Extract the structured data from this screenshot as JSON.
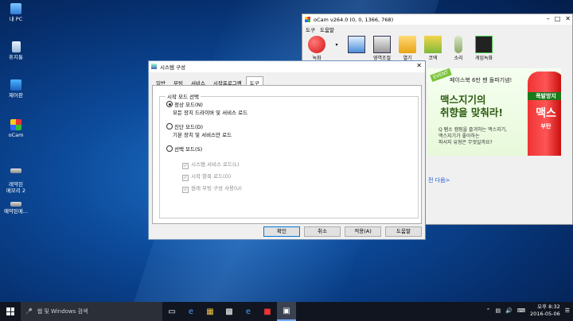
{
  "desktop": {
    "icons": [
      {
        "label": "내 PC",
        "icon": "this-pc-icon"
      },
      {
        "label": "휴지통",
        "icon": "recycle-bin-icon"
      },
      {
        "label": "제어판",
        "icon": "control-panel-icon"
      },
      {
        "label": "oCam",
        "icon": "ocam-icon"
      },
      {
        "label": "레약된\n메모리 2",
        "icon": "memory-icon"
      },
      {
        "label": "예약된메...",
        "icon": "memory-icon"
      }
    ]
  },
  "ocam": {
    "title": "oCam v264.0 (0, 0, 1366, 768)",
    "menu": [
      "도구",
      "도움말"
    ],
    "tools": [
      {
        "label": "녹화",
        "icon": "record-icon"
      },
      {
        "label": "",
        "icon": "screen-size-icon"
      },
      {
        "label": "영역조절",
        "icon": "resize-region-icon"
      },
      {
        "label": "열기",
        "icon": "folder-icon"
      },
      {
        "label": "코덱",
        "icon": "codec-icon"
      },
      {
        "label": "소리",
        "icon": "microphone-icon"
      },
      {
        "label": "게임녹화",
        "icon": "game-record-icon"
      }
    ],
    "ad": {
      "event": "EVENT",
      "topline": "페이스북 6만 팬 돌파기념!",
      "headline1": "맥스지기의",
      "headline2": "취향을 맞춰라!",
      "body": "Q 팸소 캠핑을 즐겨하는 맥스지기,\n맥스지기가 좋아하는\n파서지 유형은 무엇일까요?",
      "can_band": "폭발방지",
      "can_brand": "맥스",
      "can_sub": "부탄",
      "next": "전 다음>"
    }
  },
  "dialog": {
    "title": "시스템 구성",
    "tabs": [
      "일반",
      "부팅",
      "서비스",
      "시작프로그램",
      "도구"
    ],
    "group_label": "시작 모드 선택",
    "modes": [
      {
        "label": "정상 모드(N)",
        "desc": "모든 장치 드라이버 및 서비스 로드",
        "checked": true
      },
      {
        "label": "진단 모드(D)",
        "desc": "기본 장치 및 서비스만 로드",
        "checked": false
      },
      {
        "label": "선택 모드(S)",
        "desc": "",
        "checked": false
      }
    ],
    "checks": [
      "시스템 서비스 로드(L)",
      "시작 항목 로드(O)",
      "원래 부팅 구성 사용(U)"
    ],
    "buttons": [
      "확인",
      "취소",
      "적용(A)",
      "도움말"
    ]
  },
  "taskbar": {
    "search_placeholder": "웹 및 Windows 검색",
    "time": "오후 8:32",
    "date": "2016-05-06"
  }
}
